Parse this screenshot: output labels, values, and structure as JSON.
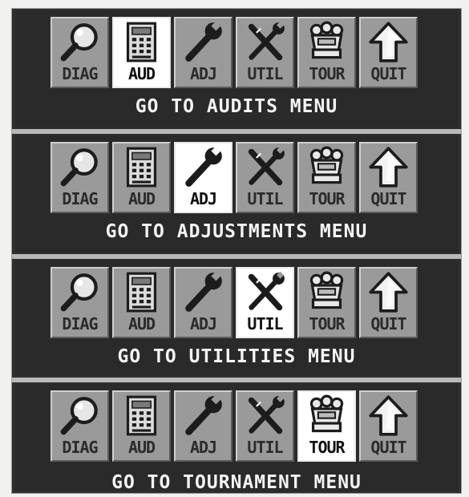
{
  "menus": [
    {
      "selected": "AUD",
      "caption": "GO TO AUDITS MENU",
      "buttons": [
        {
          "label": "DIAG",
          "icon": "magnifier-icon"
        },
        {
          "label": "AUD",
          "icon": "calculator-icon"
        },
        {
          "label": "ADJ",
          "icon": "wrench-icon"
        },
        {
          "label": "UTIL",
          "icon": "crossed-tools-icon"
        },
        {
          "label": "TOUR",
          "icon": "crown-icon"
        },
        {
          "label": "QUIT",
          "icon": "up-arrow-icon"
        }
      ]
    },
    {
      "selected": "ADJ",
      "caption": "GO TO ADJUSTMENTS MENU",
      "buttons": [
        {
          "label": "DIAG",
          "icon": "magnifier-icon"
        },
        {
          "label": "AUD",
          "icon": "calculator-icon"
        },
        {
          "label": "ADJ",
          "icon": "wrench-icon"
        },
        {
          "label": "UTIL",
          "icon": "crossed-tools-icon"
        },
        {
          "label": "TOUR",
          "icon": "crown-icon"
        },
        {
          "label": "QUIT",
          "icon": "up-arrow-icon"
        }
      ]
    },
    {
      "selected": "UTIL",
      "caption": "GO TO UTILITIES MENU",
      "buttons": [
        {
          "label": "DIAG",
          "icon": "magnifier-icon"
        },
        {
          "label": "AUD",
          "icon": "calculator-icon"
        },
        {
          "label": "ADJ",
          "icon": "wrench-icon"
        },
        {
          "label": "UTIL",
          "icon": "crossed-tools-icon"
        },
        {
          "label": "TOUR",
          "icon": "crown-icon"
        },
        {
          "label": "QUIT",
          "icon": "up-arrow-icon"
        }
      ]
    },
    {
      "selected": "TOUR",
      "caption": "GO TO TOURNAMENT MENU",
      "buttons": [
        {
          "label": "DIAG",
          "icon": "magnifier-icon"
        },
        {
          "label": "AUD",
          "icon": "calculator-icon"
        },
        {
          "label": "ADJ",
          "icon": "wrench-icon"
        },
        {
          "label": "UTIL",
          "icon": "crossed-tools-icon"
        },
        {
          "label": "TOUR",
          "icon": "crown-icon"
        },
        {
          "label": "QUIT",
          "icon": "up-arrow-icon"
        }
      ]
    }
  ],
  "colors": {
    "panel_background": "#2a2a2a",
    "button_face": "#9a9a9a",
    "button_selected": "#ffffff",
    "caption_text": "#f4f4f4"
  }
}
